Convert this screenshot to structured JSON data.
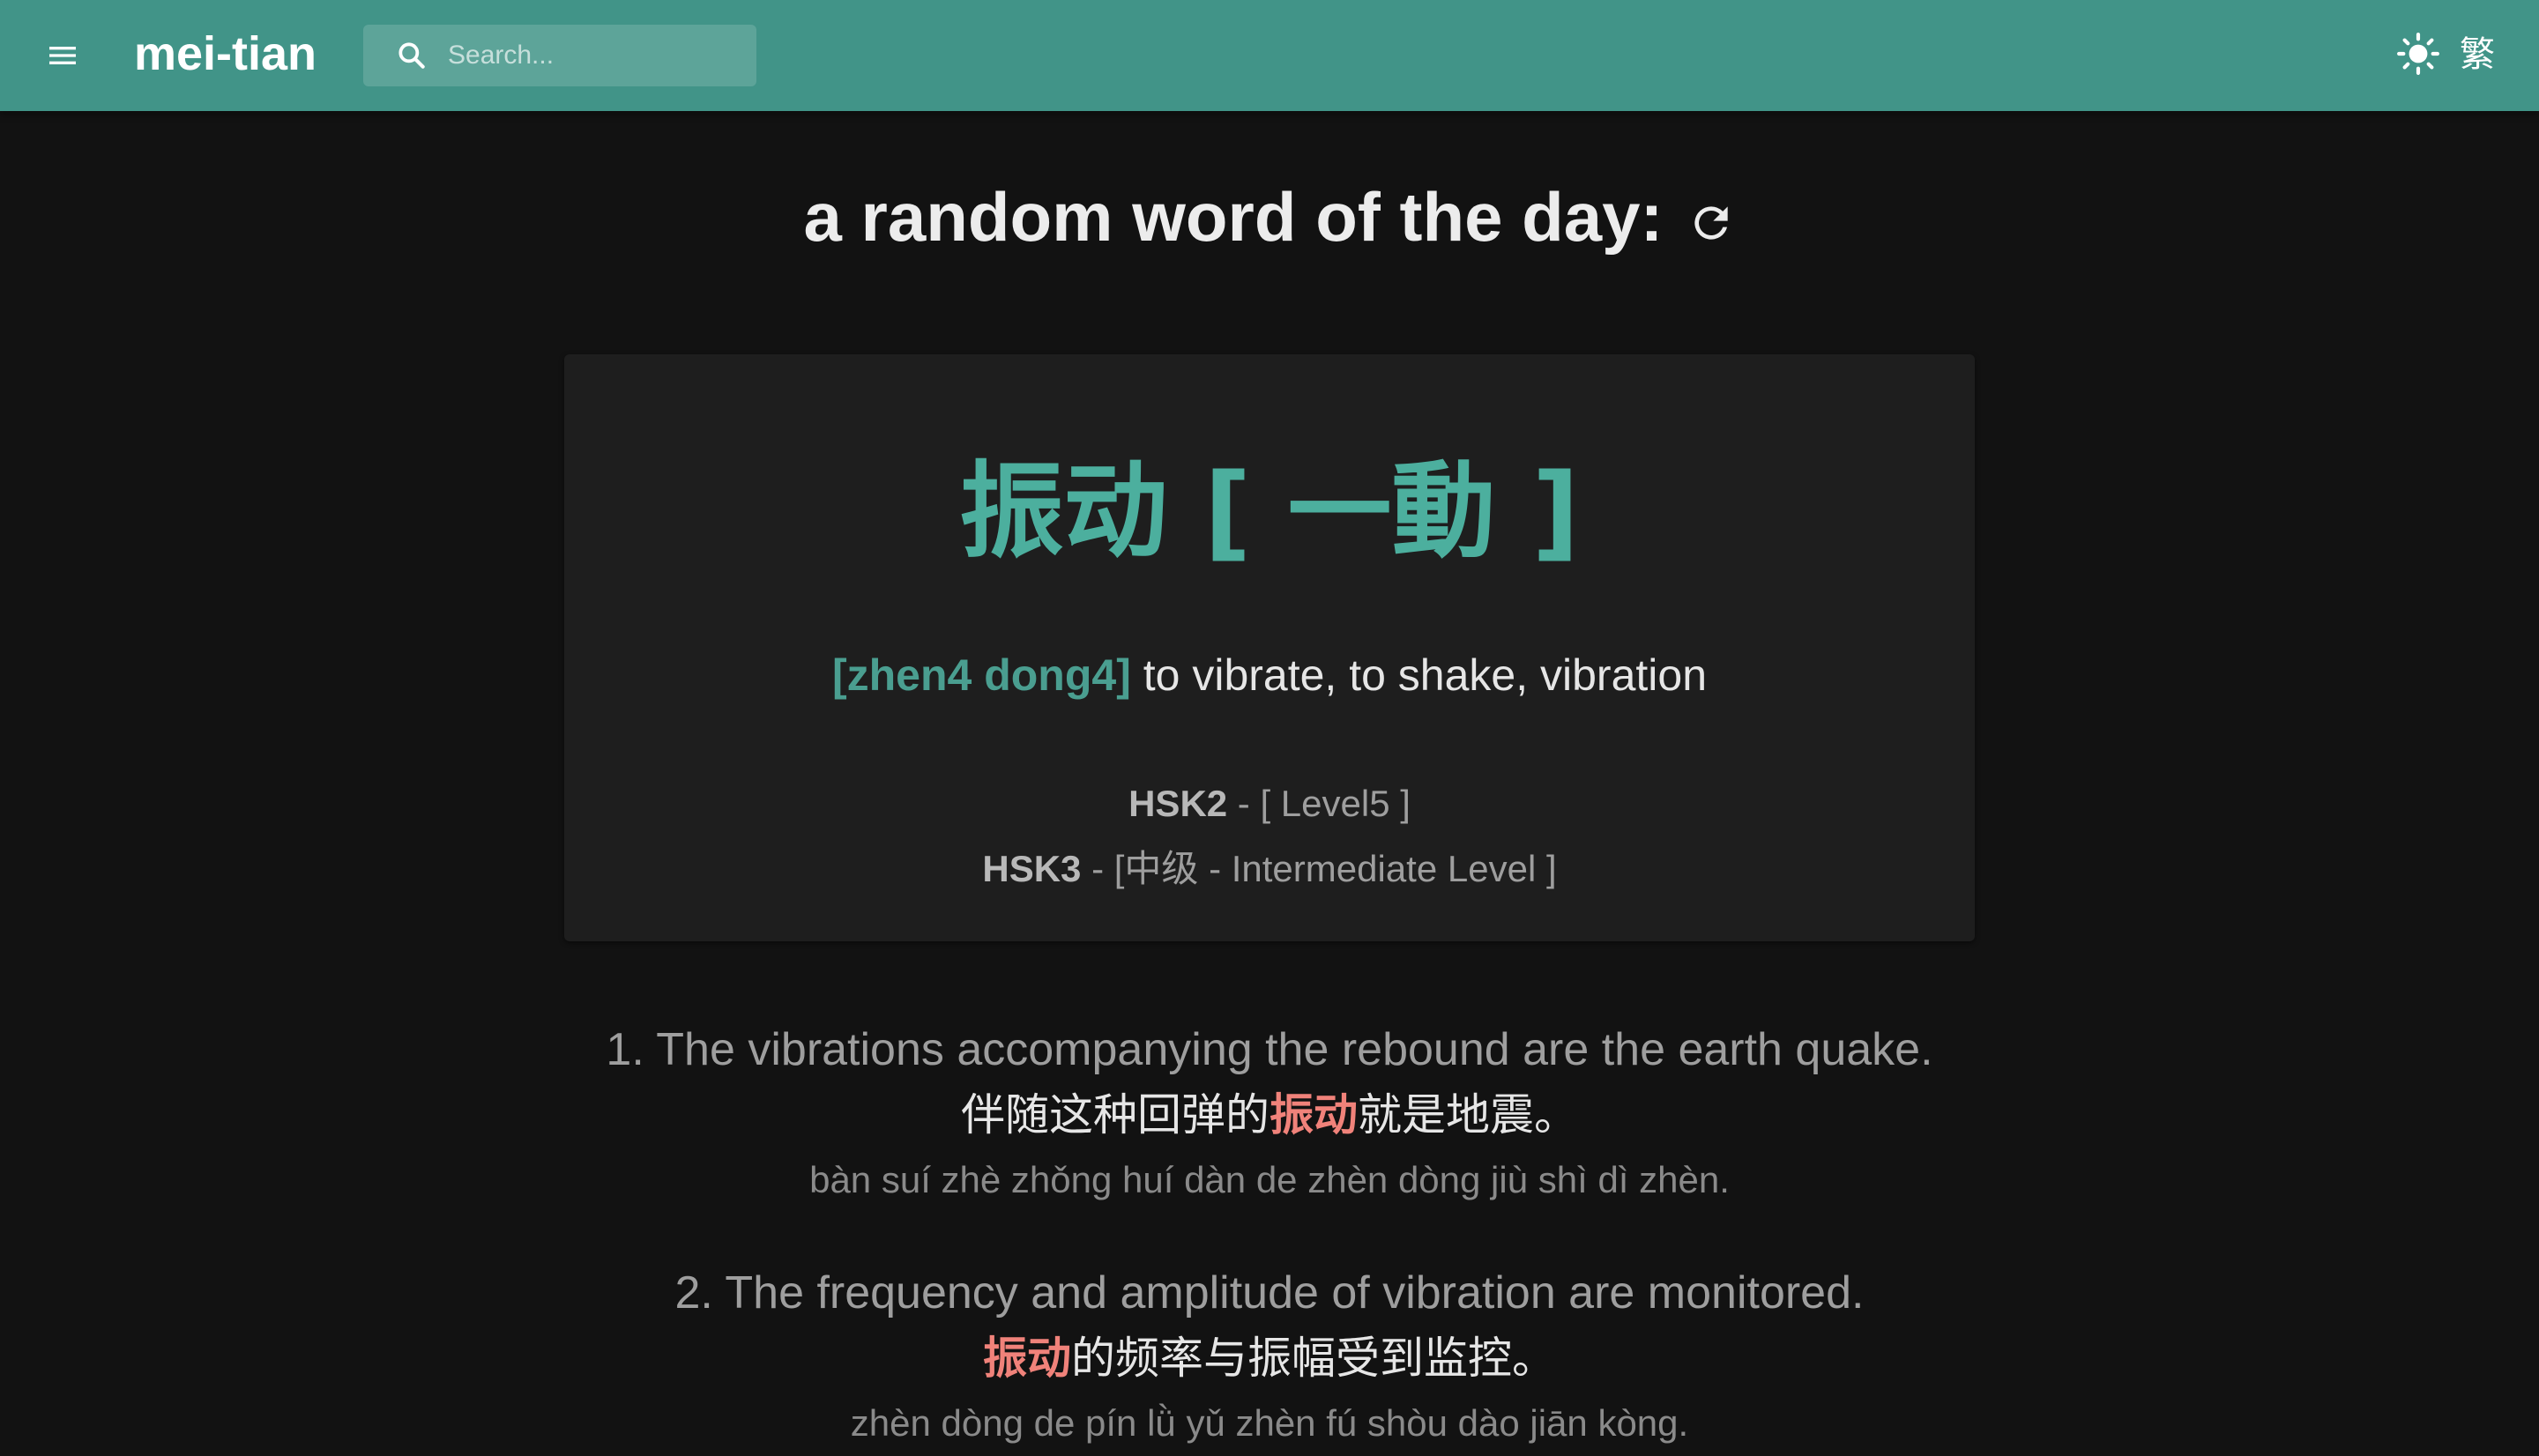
{
  "header": {
    "brand": "mei-tian",
    "search_placeholder": "Search...",
    "script_toggle_label": "繁"
  },
  "main": {
    "heading": "a random word of the day:"
  },
  "word_card": {
    "word": "振动 [ 一動 ]",
    "pinyin": "[zhen4 dong4]",
    "definition": "to vibrate, to shake, vibration",
    "hsk2_label": "HSK2",
    "hsk2_value": " - [ Level5 ]",
    "hsk3_label": "HSK3",
    "hsk3_value": " - [中级 - Intermediate Level ]"
  },
  "examples": [
    {
      "english": "1. The vibrations accompanying the rebound are the earth quake.",
      "chinese_before": "伴随这种回弹的",
      "chinese_highlight": "振动",
      "chinese_after": "就是地震。",
      "pinyin": "bàn suí zhè zhǒng huí dàn de zhèn dòng jiù shì dì zhèn."
    },
    {
      "english": "2. The frequency and amplitude of vibration are monitored.",
      "chinese_before": "",
      "chinese_highlight": "振动",
      "chinese_after": "的频率与振幅受到监控。",
      "pinyin": "zhèn dòng de pín lǜ yǔ zhèn fú shòu dào jiān kòng."
    }
  ],
  "colors": {
    "appbar": "#419488",
    "accent": "#4caf9e",
    "highlight": "#f0827a",
    "background": "#121212",
    "card": "#1e1e1e"
  },
  "icons": [
    "menu-icon",
    "search-icon",
    "sun-icon",
    "refresh-icon"
  ]
}
